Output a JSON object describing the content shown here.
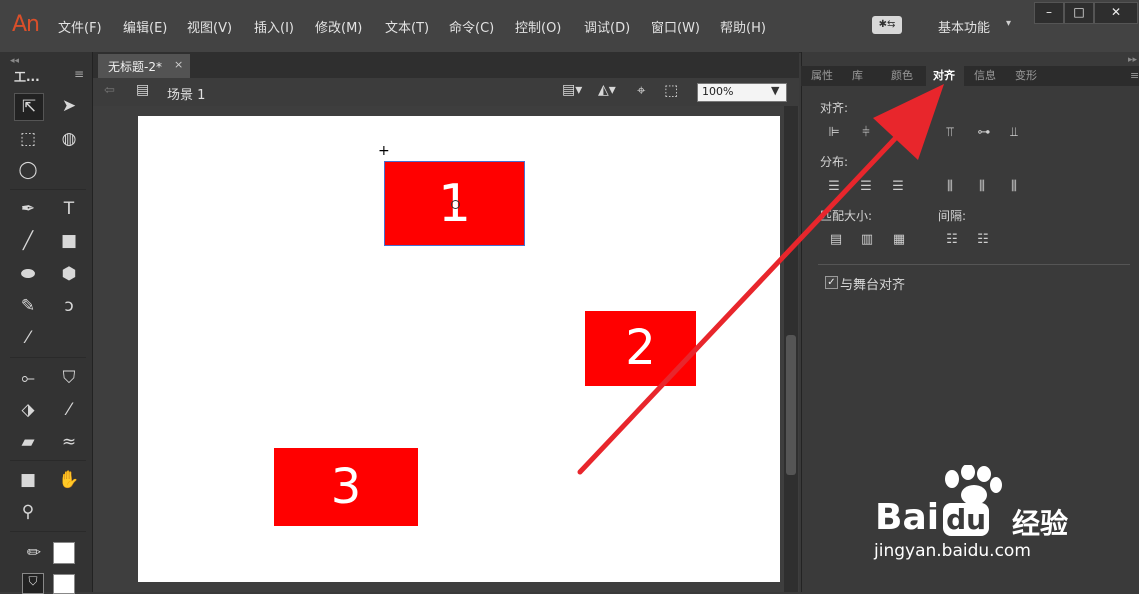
{
  "app": {
    "logo": "An"
  },
  "menu": [
    "文件(F)",
    "编辑(E)",
    "视图(V)",
    "插入(I)",
    "修改(M)",
    "文本(T)",
    "命令(C)",
    "控制(O)",
    "调试(D)",
    "窗口(W)",
    "帮助(H)"
  ],
  "workspace": {
    "icon": "sync-icon",
    "label": "基本功能",
    "caret": "▾"
  },
  "window_buttons": [
    "–",
    "□",
    "✕"
  ],
  "tools": {
    "title": "工...",
    "menu_glyph": "≡"
  },
  "document": {
    "tab_label": "无标题-2*",
    "close": "×",
    "scene": "场景 1",
    "zoom": "100%"
  },
  "stage": {
    "shapes": [
      "1",
      "2",
      "3"
    ],
    "color": "#ff0000"
  },
  "panel": {
    "tabs": [
      "属性",
      "库",
      "颜色",
      "对齐",
      "信息",
      "变形"
    ],
    "active_tab": "对齐",
    "align_label": "对齐:",
    "distribute_label": "分布:",
    "match_size_label": "匹配大小:",
    "spacing_label": "间隔:",
    "align_to_stage_label": "与舞台对齐",
    "align_to_stage_checked": true
  },
  "watermark": {
    "brand": "Bai",
    "brand_cn": "经验",
    "url": "jingyan.baidu.com"
  },
  "annotation_color": "#e8262c"
}
